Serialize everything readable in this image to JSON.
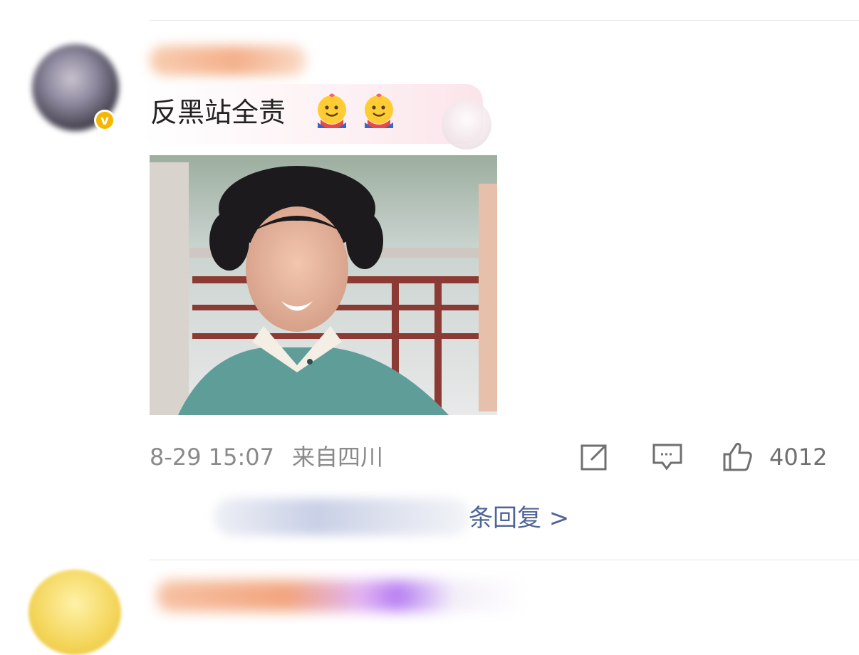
{
  "post": {
    "comment_text": "反黑站全责",
    "emojis": [
      "hug-emoji",
      "hug-emoji"
    ],
    "timestamp": "8-29 15:07",
    "location": "来自四川",
    "like_count": "4012",
    "replies_link": "条回复 >"
  },
  "icons": {
    "share": "share-icon",
    "comment": "comment-icon",
    "like": "thumbs-up-icon",
    "verified": "verified-badge-icon"
  },
  "colors": {
    "link": "#4e6596",
    "meta_text": "#8a8a8a",
    "verified_badge": "#f5b700"
  }
}
